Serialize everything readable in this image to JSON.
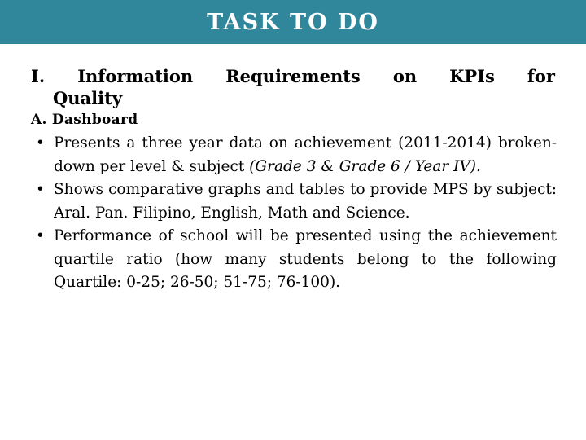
{
  "slide": {
    "title": "TASK TO DO",
    "title_band_color": "#30879C",
    "title_text_color": "#FFFFFF",
    "background_color": "#FFFFFF",
    "body_text_color": "#000000"
  },
  "content": {
    "roman_heading": {
      "line1": "I.  Information Requirements on  KPIs  for",
      "line2": "Quality"
    },
    "letter_heading": "A. Dashboard",
    "bullets": [
      {
        "marker": "•",
        "text_before_italic": "Presents a three year data on achievement (2011-2014) broken-down per level & subject ",
        "italic_text": "(Grade 3 & Grade 6 / Year IV).",
        "text_after_italic": ""
      },
      {
        "marker": "•",
        "text_before_italic": "Shows comparative graphs and tables to provide MPS by subject: Aral. Pan. Filipino, English, Math and Science.",
        "italic_text": "",
        "text_after_italic": ""
      },
      {
        "marker": "•",
        "text_before_italic": "Performance of school will be presented using the achievement quartile ratio (how many students belong to the following Quartile: 0-25; 26-50; 51-75; 76-100).",
        "italic_text": "",
        "text_after_italic": ""
      }
    ]
  }
}
